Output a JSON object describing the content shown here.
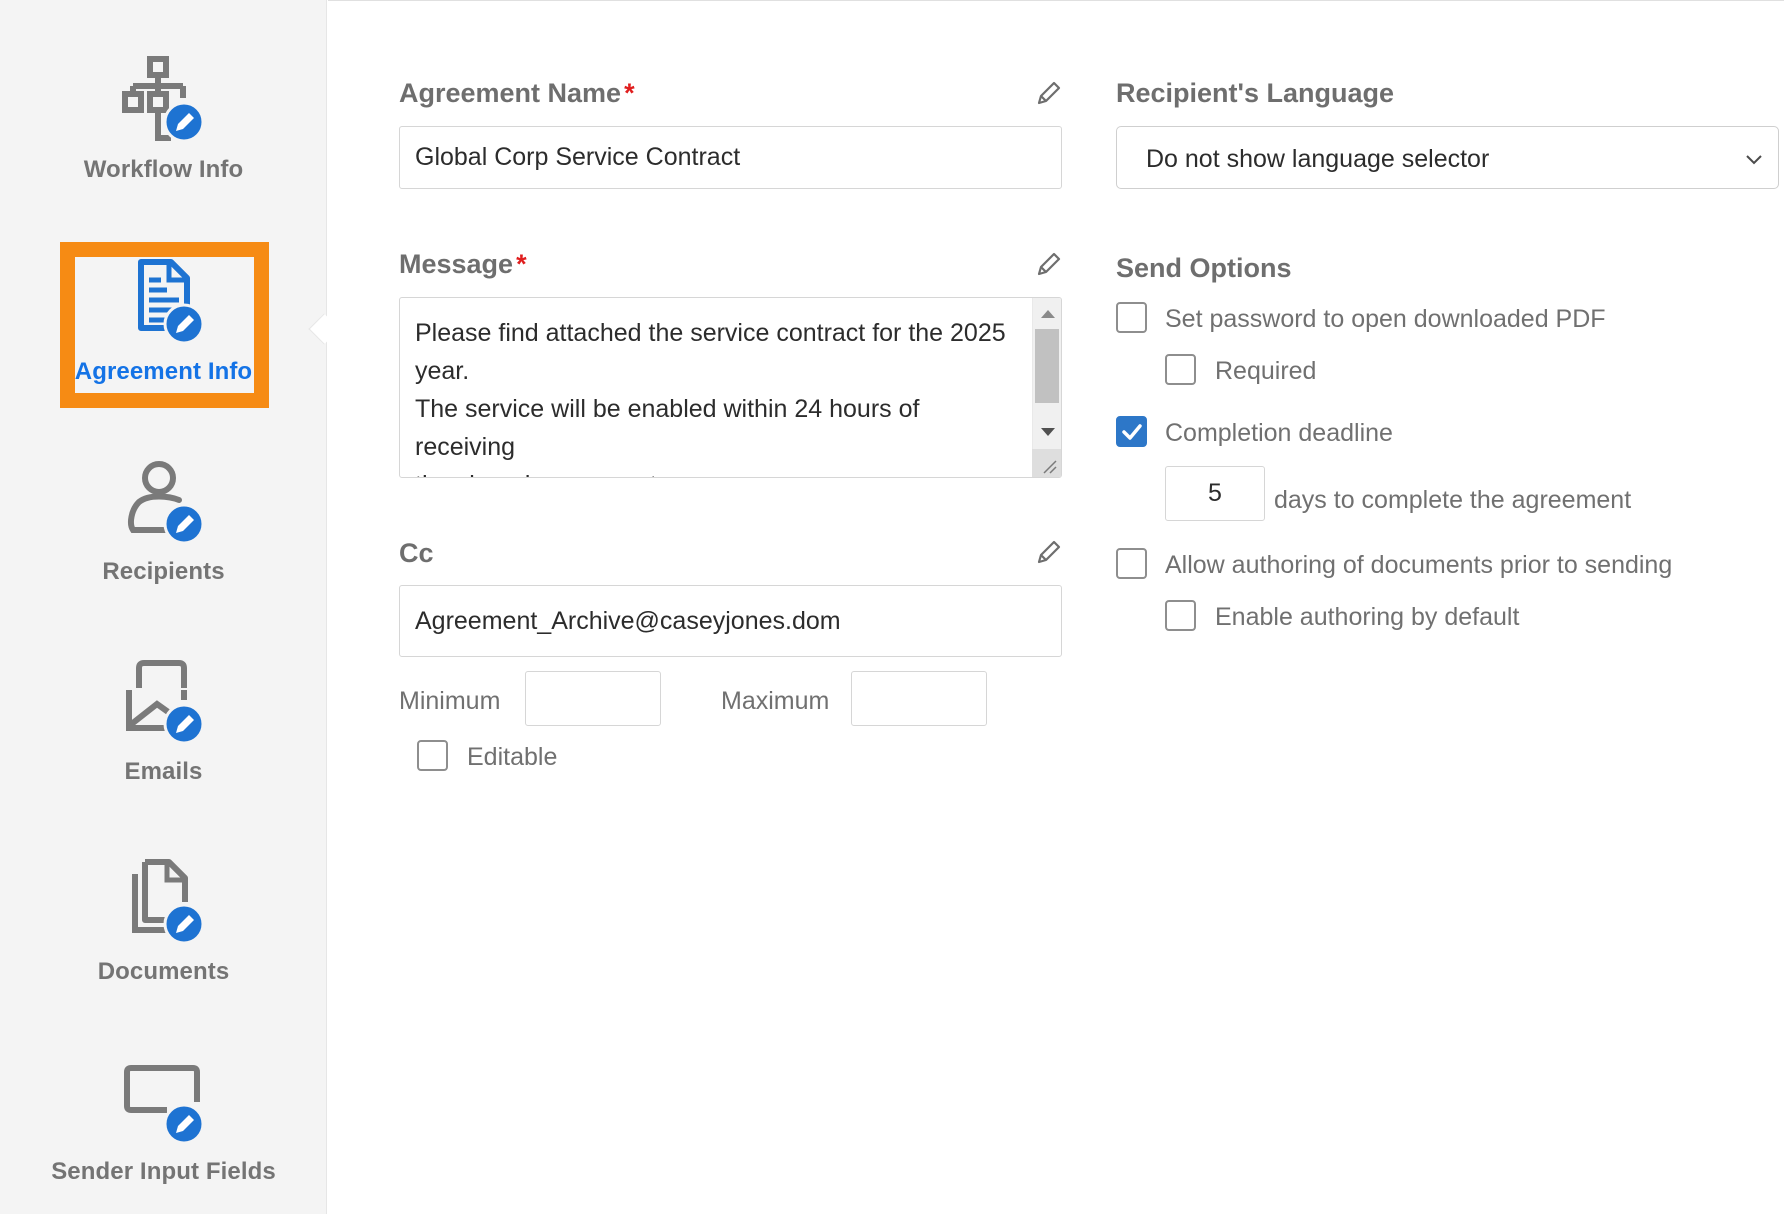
{
  "sidebar": {
    "items": [
      {
        "label": "Workflow Info",
        "icon": "workflow-icon",
        "active": false
      },
      {
        "label": "Agreement Info",
        "icon": "document-icon",
        "active": true
      },
      {
        "label": "Recipients",
        "icon": "user-icon",
        "active": false
      },
      {
        "label": "Emails",
        "icon": "email-icon",
        "active": false
      },
      {
        "label": "Documents",
        "icon": "documents-icon",
        "active": false
      },
      {
        "label": "Sender Input Fields",
        "icon": "input-field-icon",
        "active": false
      }
    ],
    "highlight_color": "#f68b14",
    "active_color": "#1473e6"
  },
  "agreement_name": {
    "label": "Agreement Name",
    "required_mark": "*",
    "value": "Global Corp Service Contract"
  },
  "message": {
    "label": "Message",
    "required_mark": "*",
    "value": "Please find attached the service contract for the 2025 year.\nThe service will be enabled within 24 hours of receiving\nthe signed agreement.\nIf you have any questions or concerns, please contact Gail"
  },
  "cc": {
    "label": "Cc",
    "value": "Agreement_Archive@caseyjones.dom",
    "minimum_label": "Minimum",
    "minimum_value": "",
    "maximum_label": "Maximum",
    "maximum_value": "",
    "editable_label": "Editable",
    "editable_checked": false
  },
  "recipient_language": {
    "label": "Recipient's Language",
    "selected": "Do not show language selector"
  },
  "send_options": {
    "title": "Send Options",
    "set_password": {
      "label": "Set password to open downloaded PDF",
      "checked": false
    },
    "required": {
      "label": "Required",
      "checked": false
    },
    "completion_deadline": {
      "label": "Completion deadline",
      "checked": true
    },
    "days_value": "5",
    "days_suffix": "days to complete the agreement",
    "allow_authoring": {
      "label": "Allow authoring of documents prior to sending",
      "checked": false
    },
    "enable_authoring_default": {
      "label": "Enable authoring by default",
      "checked": false
    }
  }
}
